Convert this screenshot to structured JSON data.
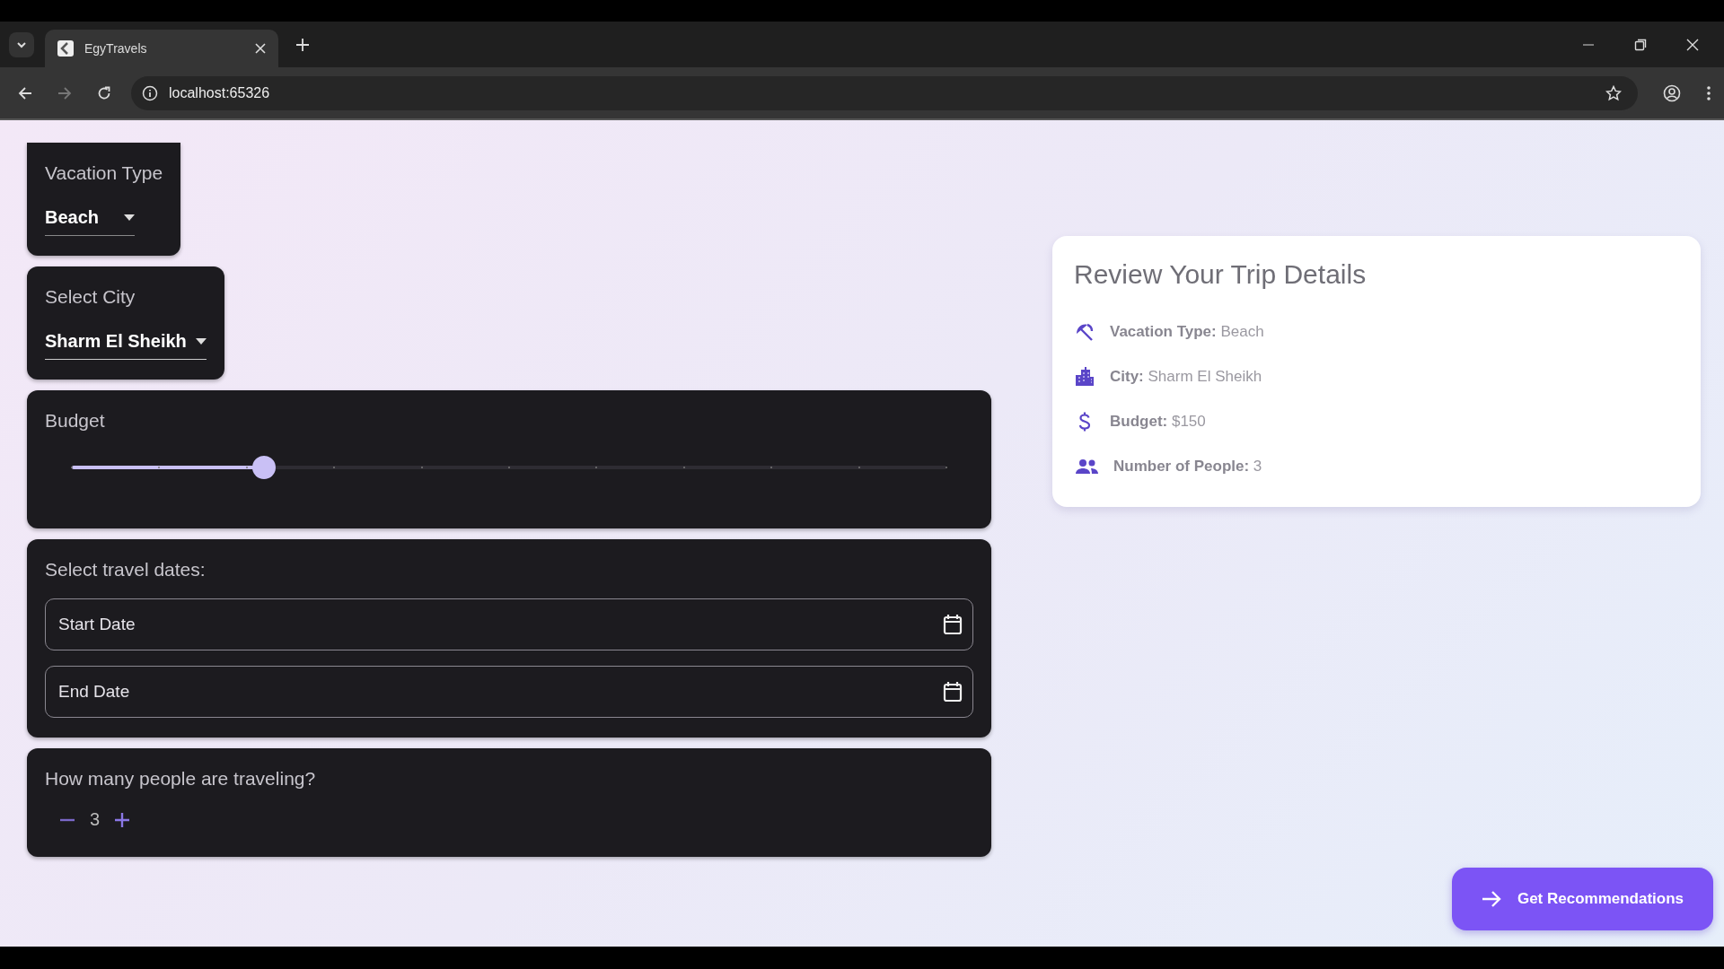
{
  "browser": {
    "tab": {
      "title": "EgyTravels",
      "selected": true
    },
    "url": "localhost:65326"
  },
  "form": {
    "vacation_type": {
      "label": "Vacation Type",
      "value": "Beach"
    },
    "city": {
      "label": "Select City",
      "value": "Sharm El Sheikh"
    },
    "budget": {
      "label": "Budget",
      "level": 0.22
    },
    "dates": {
      "label": "Select travel dates:",
      "fields": [
        {
          "placeholder": "Start Date"
        },
        {
          "placeholder": "End Date"
        }
      ]
    },
    "people": {
      "label": "How many people are traveling?",
      "value": "3"
    }
  },
  "review": {
    "title": "Review Your Trip Details",
    "items": [
      {
        "kind": "beach",
        "label": "Vacation Type:",
        "value": "Beach"
      },
      {
        "kind": "city",
        "label": "City:",
        "value": "Sharm El Sheikh"
      },
      {
        "kind": "budget",
        "label": "Budget:",
        "value": "$150"
      },
      {
        "kind": "people",
        "label": "Number of People:",
        "value": "3"
      }
    ]
  },
  "action_button": {
    "label": "Get Recommendations"
  }
}
